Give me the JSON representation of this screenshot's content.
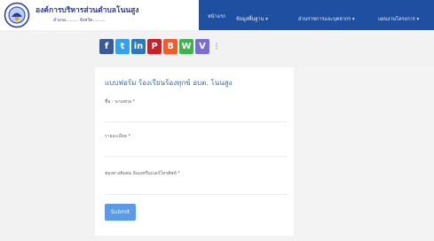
{
  "header": {
    "org_name": "องค์การบริหารส่วนตำบลโนนสูง",
    "org_sub": "อำเภอ......... จังหวัด.........",
    "nav": [
      {
        "label": "หน้าแรก"
      },
      {
        "label": "ข้อมูลพื้นฐาน ▾"
      },
      {
        "label": "ส่วนราชการและบุคลากร ▾"
      },
      {
        "label": "แผนงานโครงการ ▾"
      }
    ]
  },
  "social": {
    "icons": [
      "facebook-icon",
      "twitter-icon",
      "linkedin-icon",
      "pinterest-icon",
      "blogger-icon",
      "whatsapp-icon",
      "viber-icon",
      "more-icon"
    ],
    "glyphs": [
      "f",
      "t",
      "in",
      "P",
      "B",
      "W",
      "V",
      "⋮"
    ]
  },
  "form": {
    "title": "แบบฟอร์ม ร้องเรียนร้องทุกข์ อบต. โนนสูง",
    "fields": [
      {
        "label": "ชื่อ - นามสกุล *"
      },
      {
        "label": "รายละเอียด *"
      },
      {
        "label": "ช่องทางติดต่อ อีเมลหรือเบอร์โทรศัพท์ *"
      }
    ],
    "submit_label": "Submit"
  },
  "colors": {
    "nav_bg": "#1f4fa0",
    "brand_text": "#2a3aa0",
    "submit_bg": "#5b9be5",
    "page_bg": "#f2f2f2"
  }
}
